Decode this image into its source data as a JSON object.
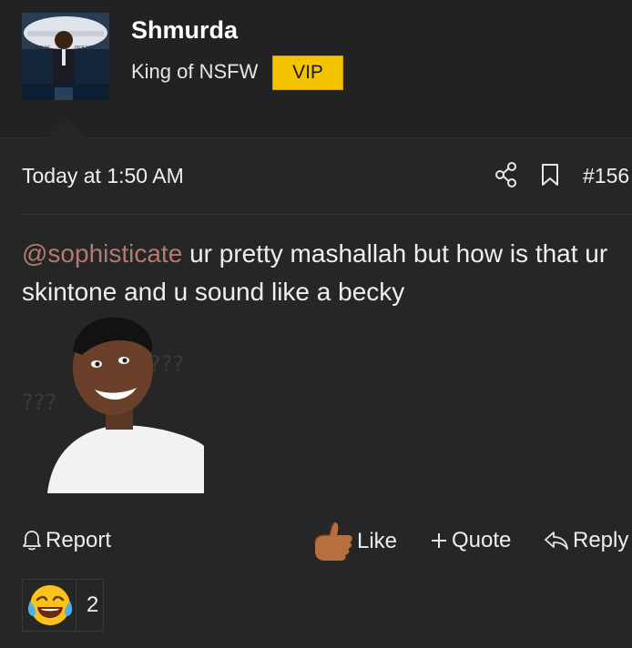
{
  "user": {
    "name": "Shmurda",
    "title": "King of NSFW",
    "badge": "VIP",
    "avatar_banner_text": "THE WHITE HOUSE"
  },
  "post": {
    "date": "Today at 1:50 AM",
    "number": "#156",
    "mention": "@sophisticate",
    "text": " ur pretty mashallah but how is that ur skintone and u sound like a becky",
    "meme_text_left": "???",
    "meme_text_right": "???"
  },
  "actions": {
    "report": "Report",
    "like": "Like",
    "quote": "Quote",
    "reply": "Reply"
  },
  "reaction": {
    "icon": "laughing-crying-emoji",
    "count": "2"
  },
  "colors": {
    "background": "#222222",
    "vip_badge": "#f5c400",
    "mention": "#b37a74"
  }
}
